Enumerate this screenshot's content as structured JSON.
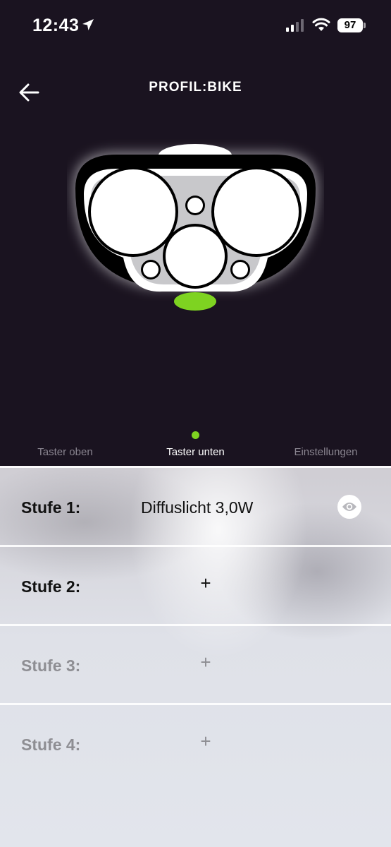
{
  "status": {
    "time": "12:43",
    "battery": "97"
  },
  "header": {
    "title": "PROFIL:BIKE"
  },
  "tabs": [
    {
      "label": "Taster oben",
      "active": false
    },
    {
      "label": "Taster unten",
      "active": true
    },
    {
      "label": "Einstellungen",
      "active": false
    }
  ],
  "rows": [
    {
      "label": "Stufe 1:",
      "value": "Diffuslicht 3,0W"
    },
    {
      "label": "Stufe 2:",
      "add": "+"
    },
    {
      "label": "Stufe 3:",
      "add": "+"
    },
    {
      "label": "Stufe 4:",
      "add": "+"
    }
  ],
  "colors": {
    "background": "#1a1320",
    "accent": "#7ed321"
  },
  "icons": [
    "location-arrow-icon",
    "signal-icon",
    "wifi-icon",
    "battery-icon",
    "back-arrow-icon",
    "eye-icon"
  ]
}
